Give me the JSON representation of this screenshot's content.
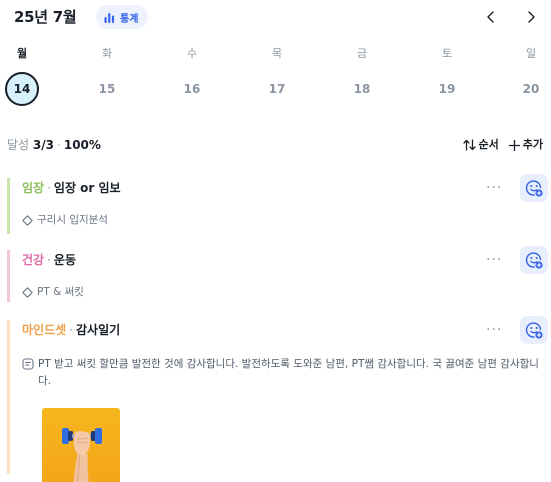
{
  "header": {
    "month_title": "25년 7월",
    "stats_label": "통계",
    "prev_icon": "chevron-left-icon",
    "next_icon": "chevron-right-icon"
  },
  "week": {
    "days": [
      "월",
      "화",
      "수",
      "목",
      "금",
      "토",
      "일"
    ],
    "dates": [
      "14",
      "15",
      "16",
      "17",
      "18",
      "19",
      "20"
    ],
    "selected_index": 0
  },
  "summary": {
    "label": "달성",
    "count": "3/3",
    "separator": "·",
    "percent": "100%",
    "sort_label": "순서",
    "add_label": "추가"
  },
  "tasks": [
    {
      "category": "임장",
      "separator": "·",
      "title": "임장 or 임보",
      "subtask": "구리시 입지분석",
      "category_color": "#8bbf5a",
      "bar_color": "#c9e6a8"
    },
    {
      "category": "건강",
      "separator": "·",
      "title": "운동",
      "subtask": "PT & 써킷",
      "category_color": "#e06aa6",
      "bar_color": "#f3c5dc"
    },
    {
      "category": "마인드셋",
      "separator": "·",
      "title": "감사일기",
      "memo": "PT 받고 써킷 할만큼 발전한 것에 감사합니다. 발전하도록 도와준 남편, PT쌤 감사합니다. 국 끓여준 남편 감사합니다.",
      "category_color": "#f0a24a",
      "bar_color": "#fbe2bd"
    }
  ],
  "more_label": "···",
  "colors": {
    "accent": "#3563e9",
    "selected_date_bg": "#d6f1fb",
    "face_btn_bg": "#e8eefc"
  }
}
